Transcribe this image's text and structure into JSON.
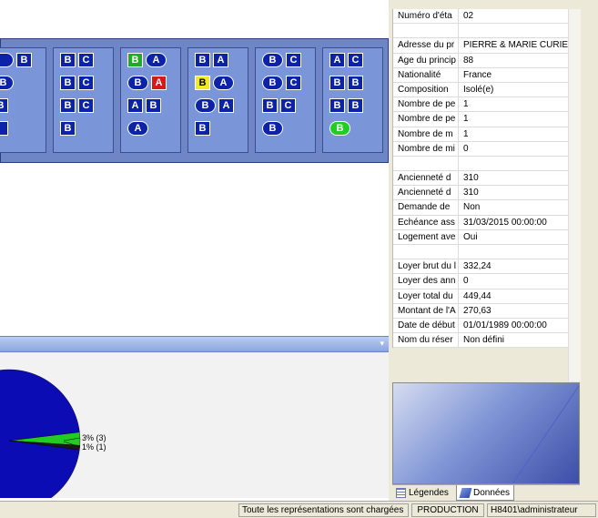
{
  "grid": {
    "stairs": [
      {
        "rows": [
          [
            {
              "t": "",
              "s": "ov",
              "c": "blue"
            },
            {
              "t": "B",
              "s": "sq",
              "c": "blue"
            }
          ],
          [
            {
              "t": "B",
              "s": "ov",
              "c": "blue"
            }
          ],
          [
            {
              "t": "B",
              "s": "sq",
              "c": "blue"
            }
          ],
          [
            {
              "t": "",
              "s": "sq",
              "c": "blue"
            }
          ]
        ]
      },
      {
        "rows": [
          [
            {
              "t": "B",
              "s": "sq",
              "c": "blue"
            },
            {
              "t": "C",
              "s": "sq",
              "c": "blue"
            }
          ],
          [
            {
              "t": "B",
              "s": "sq",
              "c": "blue"
            },
            {
              "t": "C",
              "s": "sq",
              "c": "blue"
            }
          ],
          [
            {
              "t": "B",
              "s": "sq",
              "c": "blue"
            },
            {
              "t": "C",
              "s": "sq",
              "c": "blue"
            }
          ],
          [
            {
              "t": "B",
              "s": "sq",
              "c": "blue"
            }
          ]
        ]
      },
      {
        "rows": [
          [
            {
              "t": "B",
              "s": "sq",
              "c": "green"
            },
            {
              "t": "A",
              "s": "ov",
              "c": "blue"
            }
          ],
          [
            {
              "t": "B",
              "s": "ov",
              "c": "blue"
            },
            {
              "t": "A",
              "s": "sq",
              "c": "red"
            }
          ],
          [
            {
              "t": "A",
              "s": "sq",
              "c": "blue"
            },
            {
              "t": "B",
              "s": "sq",
              "c": "blue"
            }
          ],
          [
            {
              "t": "A",
              "s": "ov",
              "c": "blue"
            }
          ]
        ]
      },
      {
        "rows": [
          [
            {
              "t": "B",
              "s": "sq",
              "c": "blue"
            },
            {
              "t": "A",
              "s": "sq",
              "c": "blue"
            }
          ],
          [
            {
              "t": "B",
              "s": "sq",
              "c": "yellow"
            },
            {
              "t": "A",
              "s": "ov",
              "c": "blue"
            }
          ],
          [
            {
              "t": "B",
              "s": "ov",
              "c": "blue"
            },
            {
              "t": "A",
              "s": "sq",
              "c": "blue"
            }
          ],
          [
            {
              "t": "B",
              "s": "sq",
              "c": "blue"
            }
          ]
        ]
      },
      {
        "rows": [
          [
            {
              "t": "B",
              "s": "ov",
              "c": "blue"
            },
            {
              "t": "C",
              "s": "sq",
              "c": "blue"
            }
          ],
          [
            {
              "t": "B",
              "s": "ov",
              "c": "blue"
            },
            {
              "t": "C",
              "s": "sq",
              "c": "blue"
            }
          ],
          [
            {
              "t": "B",
              "s": "sq",
              "c": "blue"
            },
            {
              "t": "C",
              "s": "sq",
              "c": "blue"
            }
          ],
          [
            {
              "t": "B",
              "s": "ov",
              "c": "blue"
            }
          ]
        ]
      },
      {
        "rows": [
          [
            {
              "t": "A",
              "s": "sq",
              "c": "blue"
            },
            {
              "t": "C",
              "s": "sq",
              "c": "blue"
            }
          ],
          [
            {
              "t": "B",
              "s": "sq",
              "c": "blue"
            },
            {
              "t": "B",
              "s": "sq",
              "c": "blue"
            }
          ],
          [
            {
              "t": "B",
              "s": "sq",
              "c": "blue"
            },
            {
              "t": "B",
              "s": "sq",
              "c": "blue"
            }
          ],
          [
            {
              "t": "B",
              "s": "ov",
              "c": "green"
            }
          ]
        ]
      }
    ]
  },
  "properties": [
    {
      "name": "Numéro d'éta",
      "value": "02"
    },
    {
      "name": "",
      "value": ""
    },
    {
      "name": "Adresse du pr",
      "value": "PIERRE & MARIE CURIE"
    },
    {
      "name": "Age du princip",
      "value": "88"
    },
    {
      "name": "Nationalité",
      "value": "France"
    },
    {
      "name": "Composition",
      "value": "Isolé(e)"
    },
    {
      "name": "Nombre de pe",
      "value": "1"
    },
    {
      "name": "Nombre de pe",
      "value": "1"
    },
    {
      "name": "Nombre de m",
      "value": "1"
    },
    {
      "name": "Nombre de mi",
      "value": "0"
    },
    {
      "name": "",
      "value": ""
    },
    {
      "name": "Ancienneté d",
      "value": "310"
    },
    {
      "name": "Ancienneté d",
      "value": "310"
    },
    {
      "name": "Demande de",
      "value": "Non"
    },
    {
      "name": "Echéance ass",
      "value": "31/03/2015 00:00:00"
    },
    {
      "name": "Logement ave",
      "value": "Oui"
    },
    {
      "name": "",
      "value": ""
    },
    {
      "name": "Loyer brut du l",
      "value": "332,24"
    },
    {
      "name": "Loyer des ann",
      "value": "0"
    },
    {
      "name": "Loyer total du",
      "value": "449,44"
    },
    {
      "name": "Montant de l'A",
      "value": "270,63"
    },
    {
      "name": "Date de début",
      "value": "01/01/1989 00:00:00"
    },
    {
      "name": "Nom du réser",
      "value": "Non défini"
    }
  ],
  "chart": {
    "labels": [
      "3% (3)",
      "1% (1)"
    ]
  },
  "chart_data": {
    "type": "pie",
    "slices": [
      {
        "label": "3% (3)",
        "value": 3,
        "color": "#22cc22"
      },
      {
        "label": "1% (1)",
        "value": 1,
        "color": "#1a1a1a"
      },
      {
        "label": "",
        "value": 96,
        "color": "#0c0cb4"
      }
    ]
  },
  "tabs": [
    {
      "label": "Légendes",
      "icon": "legend-icon"
    },
    {
      "label": "Données",
      "icon": "data-icon"
    }
  ],
  "status_bar": {
    "message": "Toute les représentations sont chargées",
    "environment": "PRODUCTION",
    "user": "H8401\\administrateur"
  },
  "colors": {
    "grid_background": "#6e86c6",
    "cell_blue": "#0c22a8",
    "cell_green": "#1faa2a",
    "cell_red": "#d8181a",
    "cell_yellow": "#f0ea1e"
  }
}
